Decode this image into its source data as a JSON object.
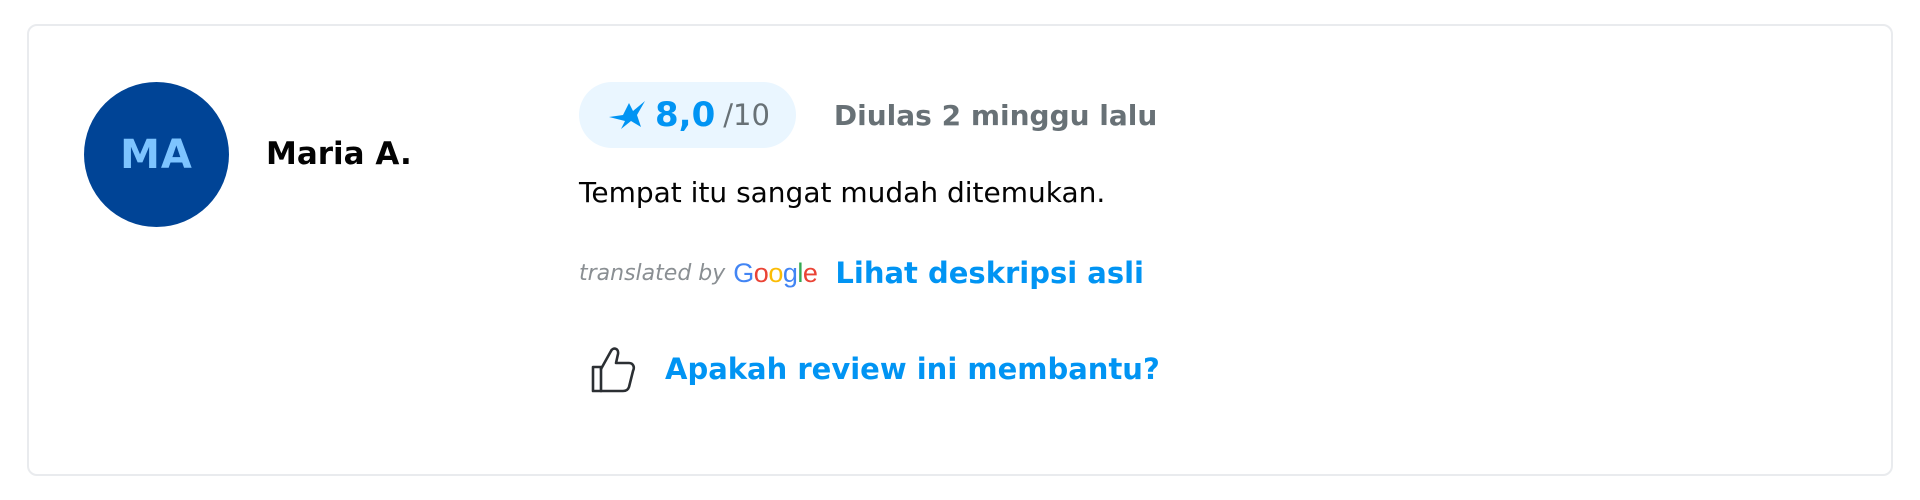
{
  "reviewer": {
    "initials": "MA",
    "name": "Maria A.",
    "avatar_color": "#004496",
    "initials_color": "#7dc4ff"
  },
  "rating": {
    "score": "8,0",
    "max": "/10",
    "icon": "traveloka-bird-icon"
  },
  "review": {
    "date": "Diulas 2 minggu lalu",
    "text": "Tempat itu sangat mudah ditemukan."
  },
  "translation": {
    "translated_by": "translated by",
    "provider": "Google",
    "see_original": "Lihat deskripsi asli"
  },
  "helpful": {
    "label": "Apakah review ini membantu?",
    "icon": "thumbs-up-icon"
  },
  "colors": {
    "accent": "#0194f3",
    "muted_text": "#687176",
    "pill_bg": "#eaf6ff",
    "card_border": "#e9ebee"
  }
}
